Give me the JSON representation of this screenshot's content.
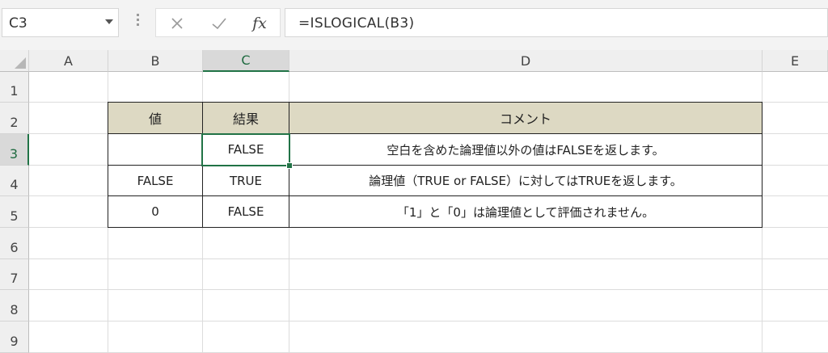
{
  "formula_bar": {
    "name_box": "C3",
    "fx_label": "fx",
    "formula": "=ISLOGICAL(B3)",
    "icons": [
      "cancel-x-icon",
      "enter-check-icon",
      "insert-function-icon"
    ]
  },
  "columns": [
    "A",
    "B",
    "C",
    "D",
    "E"
  ],
  "rows": [
    "1",
    "2",
    "3",
    "4",
    "5",
    "6",
    "7",
    "8",
    "9"
  ],
  "selected_cell": "C3",
  "table": {
    "headers": [
      "値",
      "結果",
      "コメント"
    ],
    "rows": [
      [
        "",
        "FALSE",
        "空白を含めた論理値以外の値はFALSEを返します。"
      ],
      [
        "FALSE",
        "TRUE",
        "論理値（TRUE or FALSE）に対してはTRUEを返します。"
      ],
      [
        "0",
        "FALSE",
        "「1」と「0」は論理値として評価されません。"
      ]
    ]
  },
  "colors": {
    "header_fill": "#ddd9c3",
    "selection": "#217346"
  }
}
